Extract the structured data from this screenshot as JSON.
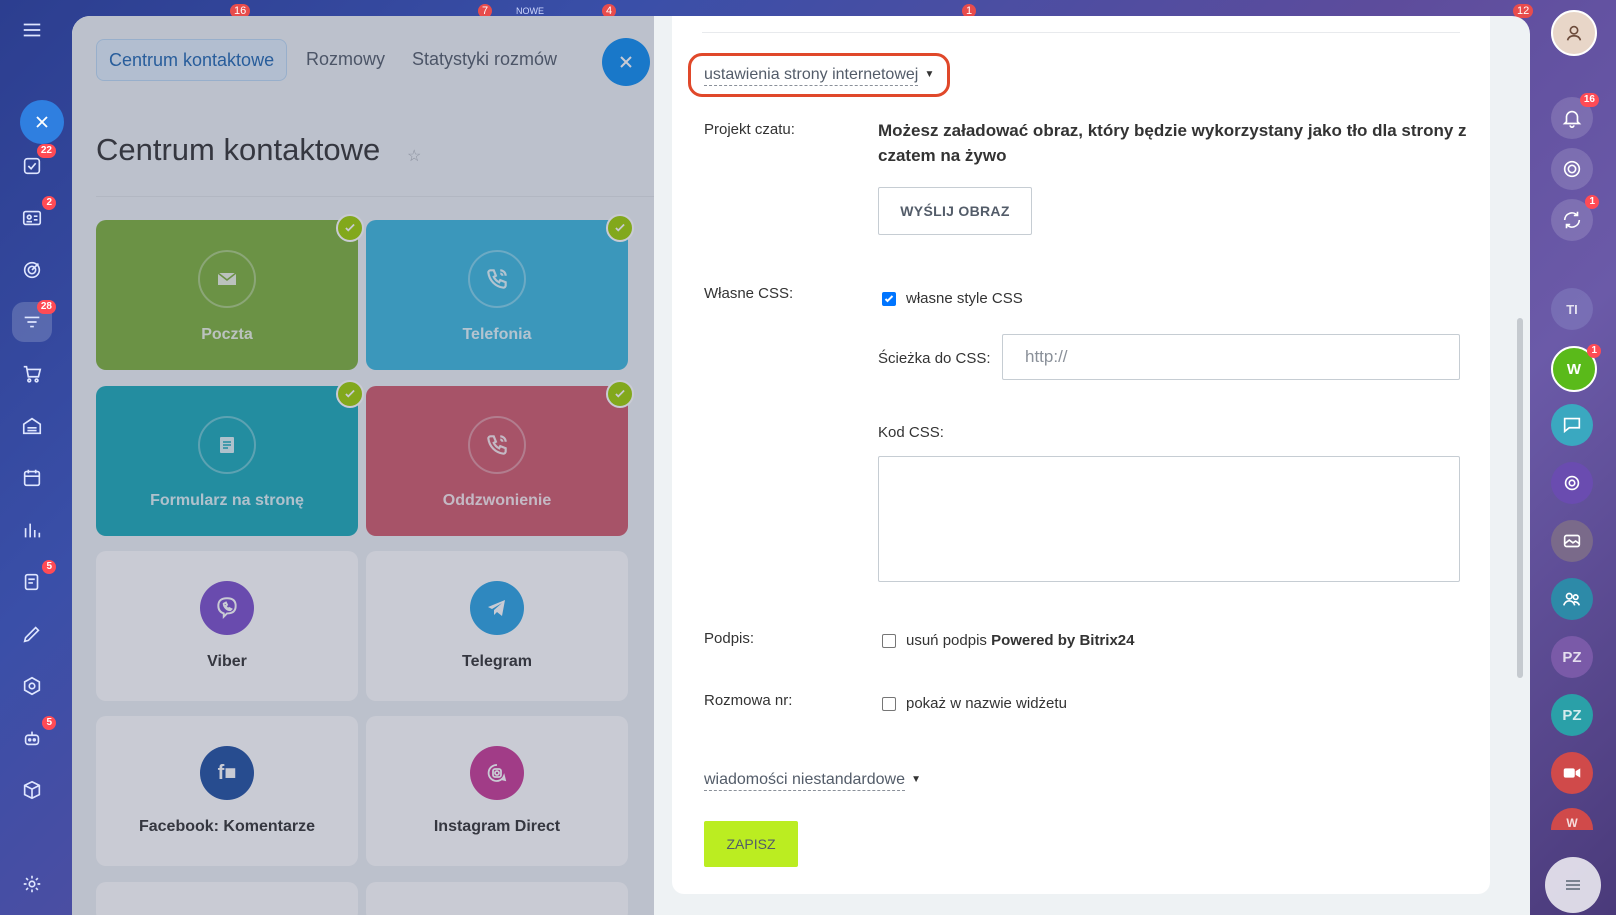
{
  "background_page": {
    "tabs": [
      {
        "label": "Centrum kontaktowe",
        "active": true
      },
      {
        "label": "Rozmowy",
        "active": false
      },
      {
        "label": "Statystyki rozmów",
        "active": false
      }
    ],
    "title": "Centrum kontaktowe",
    "tiles": [
      {
        "label": "Poczta",
        "color": "#7db13a",
        "connected": true,
        "icon": "envelope-icon"
      },
      {
        "label": "Telefonia",
        "color": "#3bb8dd",
        "connected": true,
        "icon": "phone-icon"
      },
      {
        "label": "Formularz na stronę",
        "color": "#1aa9b7",
        "connected": true,
        "icon": "form-icon"
      },
      {
        "label": "Oddzwonienie",
        "color": "#d0596a",
        "connected": true,
        "icon": "callback-icon"
      },
      {
        "label": "Viber",
        "color": "#7b4ecb",
        "connected": false,
        "icon": "viber-icon"
      },
      {
        "label": "Telegram",
        "color": "#2aa3e2",
        "connected": false,
        "icon": "telegram-icon"
      },
      {
        "label": "Facebook: Komentarze",
        "color": "#1f4fa0",
        "connected": false,
        "icon": "facebook-comments-icon"
      },
      {
        "label": "Instagram Direct",
        "color": "#c83a95",
        "connected": false,
        "icon": "instagram-icon"
      }
    ]
  },
  "left_rail": {
    "badges": {
      "tasks": "22",
      "crm": "2",
      "funnel": "28",
      "docs": "5",
      "robot": "5"
    }
  },
  "top_counters": {
    "c1": "16",
    "c2": "7",
    "c3": "NOWE",
    "c4": "4",
    "c5": "1",
    "c6": "12"
  },
  "settings": {
    "section_toggle": "ustawienia strony internetowej",
    "chat_design_label": "Projekt czatu:",
    "chat_design_desc": "Możesz załadować obraz, który będzie wykorzystany jako tło dla strony z czatem na żywo",
    "upload_button": "WYŚLIJ OBRAZ",
    "custom_css_label": "Własne CSS:",
    "custom_css_checkbox": "własne style CSS",
    "custom_css_checked": true,
    "css_path_label": "Ścieżka do CSS:",
    "css_path_placeholder": "http://",
    "css_code_label": "Kod CSS:",
    "signature_label": "Podpis:",
    "signature_checkbox_prefix": "usuń podpis ",
    "signature_checkbox_bold": "Powered by Bitrix24",
    "conversation_label": "Rozmowa nr:",
    "conversation_checkbox": "pokaż w nazwie widżetu",
    "custom_messages_toggle": "wiadomości niestandardowe",
    "save_button": "ZAPISZ"
  },
  "right_rail": {
    "notifications_badge": "16",
    "chat_badge": "1",
    "w_badge": "1",
    "initials": [
      "TI",
      "W",
      "PZ",
      "PZ",
      "W"
    ]
  },
  "colors": {
    "accent": "#0c8cf0",
    "save": "#bbed21",
    "highlight": "#e0482a",
    "badge": "#ff4b55"
  }
}
